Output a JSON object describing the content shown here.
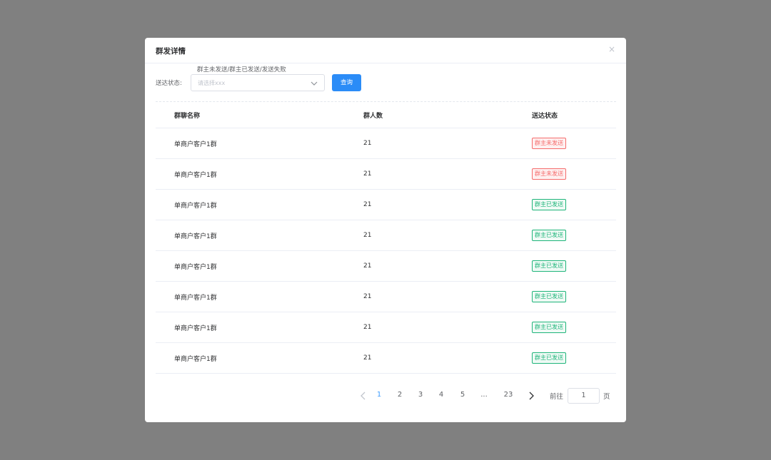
{
  "dialog": {
    "title": "群发详情",
    "close": "×"
  },
  "filter": {
    "hint": "群主未发送/群主已发送/发送失败",
    "label": "送达状态:",
    "placeholder": "请选择xxx",
    "query_label": "查询"
  },
  "table": {
    "columns": [
      "群聊名称",
      "群人数",
      "送达状态"
    ],
    "rows": [
      {
        "name": "单商户客户1群",
        "count": "21",
        "status": "群主未发送"
      },
      {
        "name": "单商户客户1群",
        "count": "21",
        "status": "群主未发送"
      },
      {
        "name": "单商户客户1群",
        "count": "21",
        "status": "群主已发送"
      },
      {
        "name": "单商户客户1群",
        "count": "21",
        "status": "群主已发送"
      },
      {
        "name": "单商户客户1群",
        "count": "21",
        "status": "群主已发送"
      },
      {
        "name": "单商户客户1群",
        "count": "21",
        "status": "群主已发送"
      },
      {
        "name": "单商户客户1群",
        "count": "21",
        "status": "群主已发送"
      },
      {
        "name": "单商户客户1群",
        "count": "21",
        "status": "群主已发送"
      }
    ]
  },
  "pagination": {
    "pages": [
      "1",
      "2",
      "3",
      "4",
      "5",
      "...",
      "23"
    ],
    "current": "1",
    "goto_prefix": "前往",
    "goto_value": "1",
    "goto_suffix": "页"
  },
  "colors": {
    "accent": "#409eff",
    "button": "#2b8cf7",
    "status_unsent": "#f56c6c",
    "status_sent": "#1fb57a"
  },
  "icons": [
    "close-icon",
    "chevron-down-icon",
    "chevron-left-icon",
    "chevron-right-icon"
  ]
}
